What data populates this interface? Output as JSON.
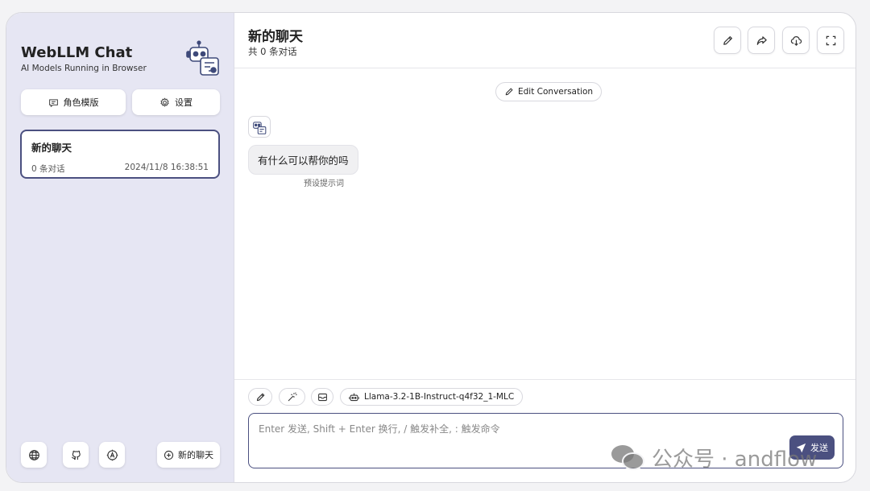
{
  "sidebar": {
    "title": "WebLLM Chat",
    "subtitle": "AI Models Running in Browser",
    "masks_label": "角色模版",
    "settings_label": "设置",
    "chat_item": {
      "title": "新的聊天",
      "count": "0 条对话",
      "time": "2024/11/8 16:38:51"
    },
    "new_chat_label": "新的聊天"
  },
  "header": {
    "title": "新的聊天",
    "subtitle": "共 0 条对话"
  },
  "chat": {
    "edit_conversation_label": "Edit Conversation",
    "message": "有什么可以帮你的吗",
    "message_note": "预设提示词"
  },
  "composer": {
    "model_label": "Llama-3.2-1B-Instruct-q4f32_1-MLC",
    "placeholder": "Enter 发送, Shift + Enter 换行, / 触发补全, : 触发命令",
    "send_label": "发送"
  },
  "watermark": {
    "text": "公众号 · andflow"
  },
  "colors": {
    "accent": "#4b5080",
    "sidebar_bg": "#e6e6f3"
  },
  "icons": {
    "header": [
      "pencil-icon",
      "share-icon",
      "cloud-download-icon",
      "fullscreen-icon"
    ],
    "footer": [
      "globe-icon",
      "github-icon",
      "auto-theme-icon"
    ]
  }
}
